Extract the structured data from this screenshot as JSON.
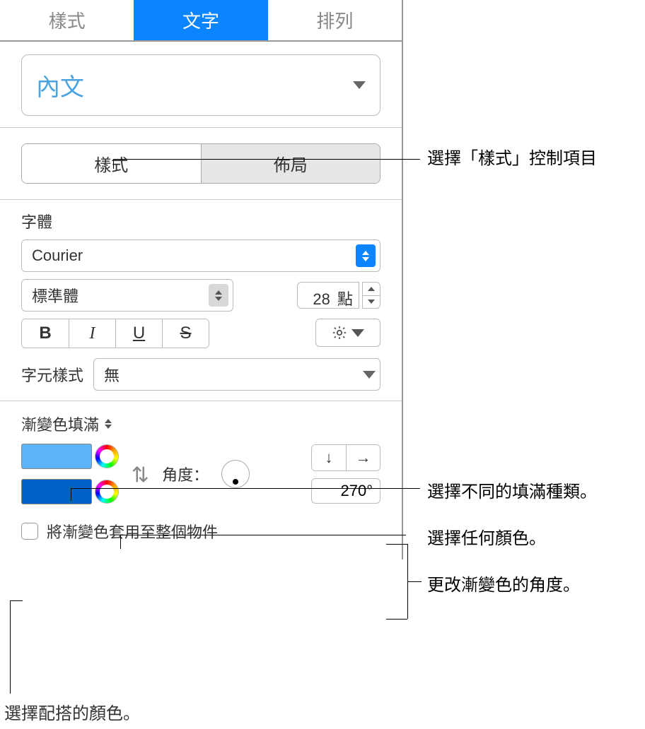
{
  "tabs": {
    "style": "樣式",
    "text": "文字",
    "arrange": "排列"
  },
  "paragraph_style": "內文",
  "subtabs": {
    "style": "樣式",
    "layout": "佈局"
  },
  "font": {
    "section_label": "字體",
    "family": "Courier",
    "weight": "標準體",
    "size_value": "28",
    "size_unit": "點",
    "b": "B",
    "i": "I",
    "u": "U",
    "s": "S"
  },
  "char_style": {
    "label": "字元樣式",
    "value": "無"
  },
  "fill": {
    "type_label": "漸變色填滿",
    "angle_label": "角度：",
    "angle_value": "270°",
    "apply_whole": "將漸變色套用至整個物件"
  },
  "callouts": {
    "c1": "選擇「樣式」控制項目",
    "c2": "選擇不同的填滿種類。",
    "c3": "選擇任何顏色。",
    "c4": "更改漸變色的角度。",
    "c5": "選擇配搭的顏色。"
  }
}
